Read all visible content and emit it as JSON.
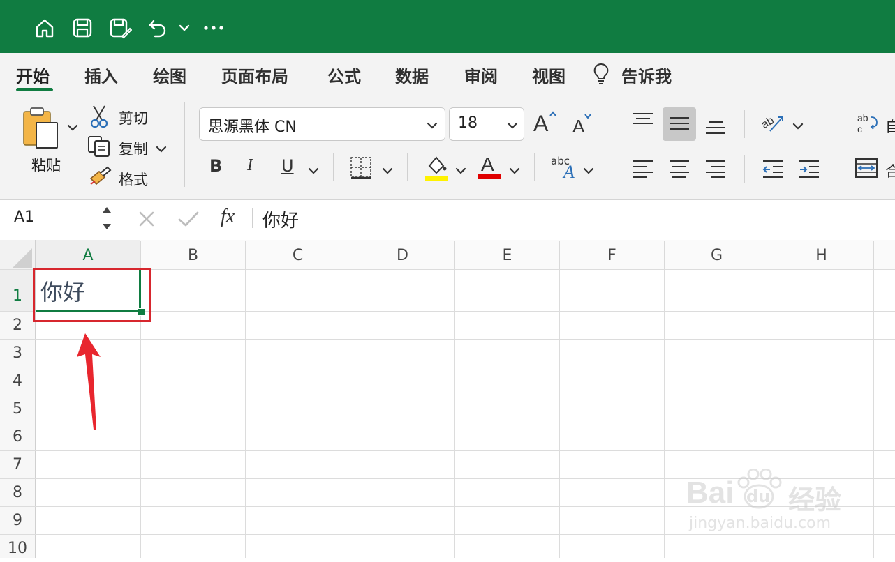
{
  "app": {
    "accent": "#107C41"
  },
  "titlebar": {
    "icons": [
      "home-icon",
      "save-icon",
      "save-as-icon",
      "undo-icon",
      "chevron-down-icon",
      "more-icon"
    ]
  },
  "menu": {
    "tabs": [
      {
        "label": "开始",
        "active": true
      },
      {
        "label": "插入"
      },
      {
        "label": "绘图"
      },
      {
        "label": "页面布局"
      },
      {
        "label": "公式"
      },
      {
        "label": "数据"
      },
      {
        "label": "审阅"
      },
      {
        "label": "视图"
      }
    ],
    "tell_me": "告诉我"
  },
  "ribbon": {
    "clipboard": {
      "paste": "粘贴",
      "cut": "剪切",
      "copy": "复制",
      "format": "格式"
    },
    "font": {
      "name": "思源黑体 CN",
      "size": "18",
      "bold": "B",
      "italic": "I",
      "underline": "U",
      "font_color_glyph": "A",
      "fill_color": "#FFF200",
      "text_color": "#E00000",
      "styles_glyph": "abc"
    },
    "wrap_fragment": "自",
    "merge_fragment": "合"
  },
  "formula_bar": {
    "name_box": "A1",
    "fx": "fx",
    "content": "你好"
  },
  "sheet": {
    "columns": [
      "A",
      "B",
      "C",
      "D",
      "E",
      "F",
      "G",
      "H"
    ],
    "rows": [
      "1",
      "2",
      "3",
      "4",
      "5",
      "6",
      "7",
      "8",
      "9",
      "10"
    ],
    "active_cell": "A1",
    "a1_value": "你好",
    "highlight_color": "#D7272E",
    "arrow_color": "#E8262E"
  },
  "watermark": {
    "brand": "Bai",
    "paw_text": "du",
    "suffix": "经验",
    "url": "jingyan.baidu.com"
  }
}
